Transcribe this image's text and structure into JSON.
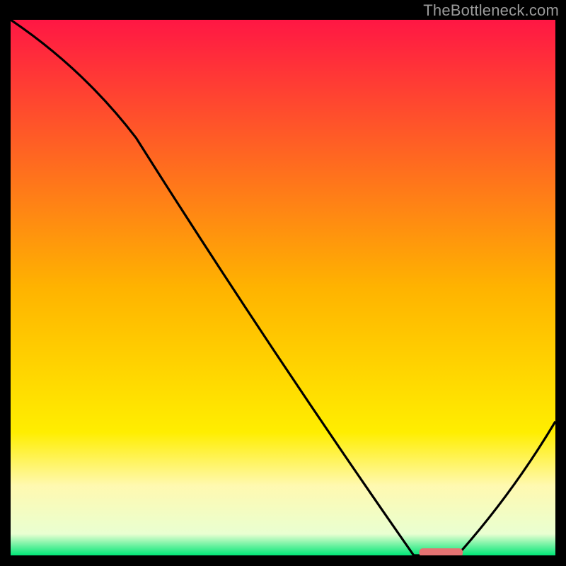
{
  "watermark": "TheBottleneck.com",
  "chart_data": {
    "type": "line",
    "title": "",
    "xlabel": "",
    "ylabel": "",
    "xlim": [
      0,
      100
    ],
    "ylim": [
      0,
      100
    ],
    "grid": false,
    "legend": false,
    "x": [
      0,
      23,
      74,
      82,
      100
    ],
    "values": [
      100,
      78,
      0,
      0,
      25
    ],
    "background_gradient": {
      "type": "vertical",
      "stops": [
        {
          "pos": 0.0,
          "color": "#ff1744"
        },
        {
          "pos": 0.5,
          "color": "#ffb300"
        },
        {
          "pos": 0.77,
          "color": "#ffee00"
        },
        {
          "pos": 0.87,
          "color": "#fff9b0"
        },
        {
          "pos": 0.96,
          "color": "#e9ffd1"
        },
        {
          "pos": 1.0,
          "color": "#00e676"
        }
      ]
    },
    "marker": {
      "x_start": 75,
      "x_end": 83,
      "y": 0,
      "color": "#e57373",
      "shape": "rounded-bar"
    }
  }
}
